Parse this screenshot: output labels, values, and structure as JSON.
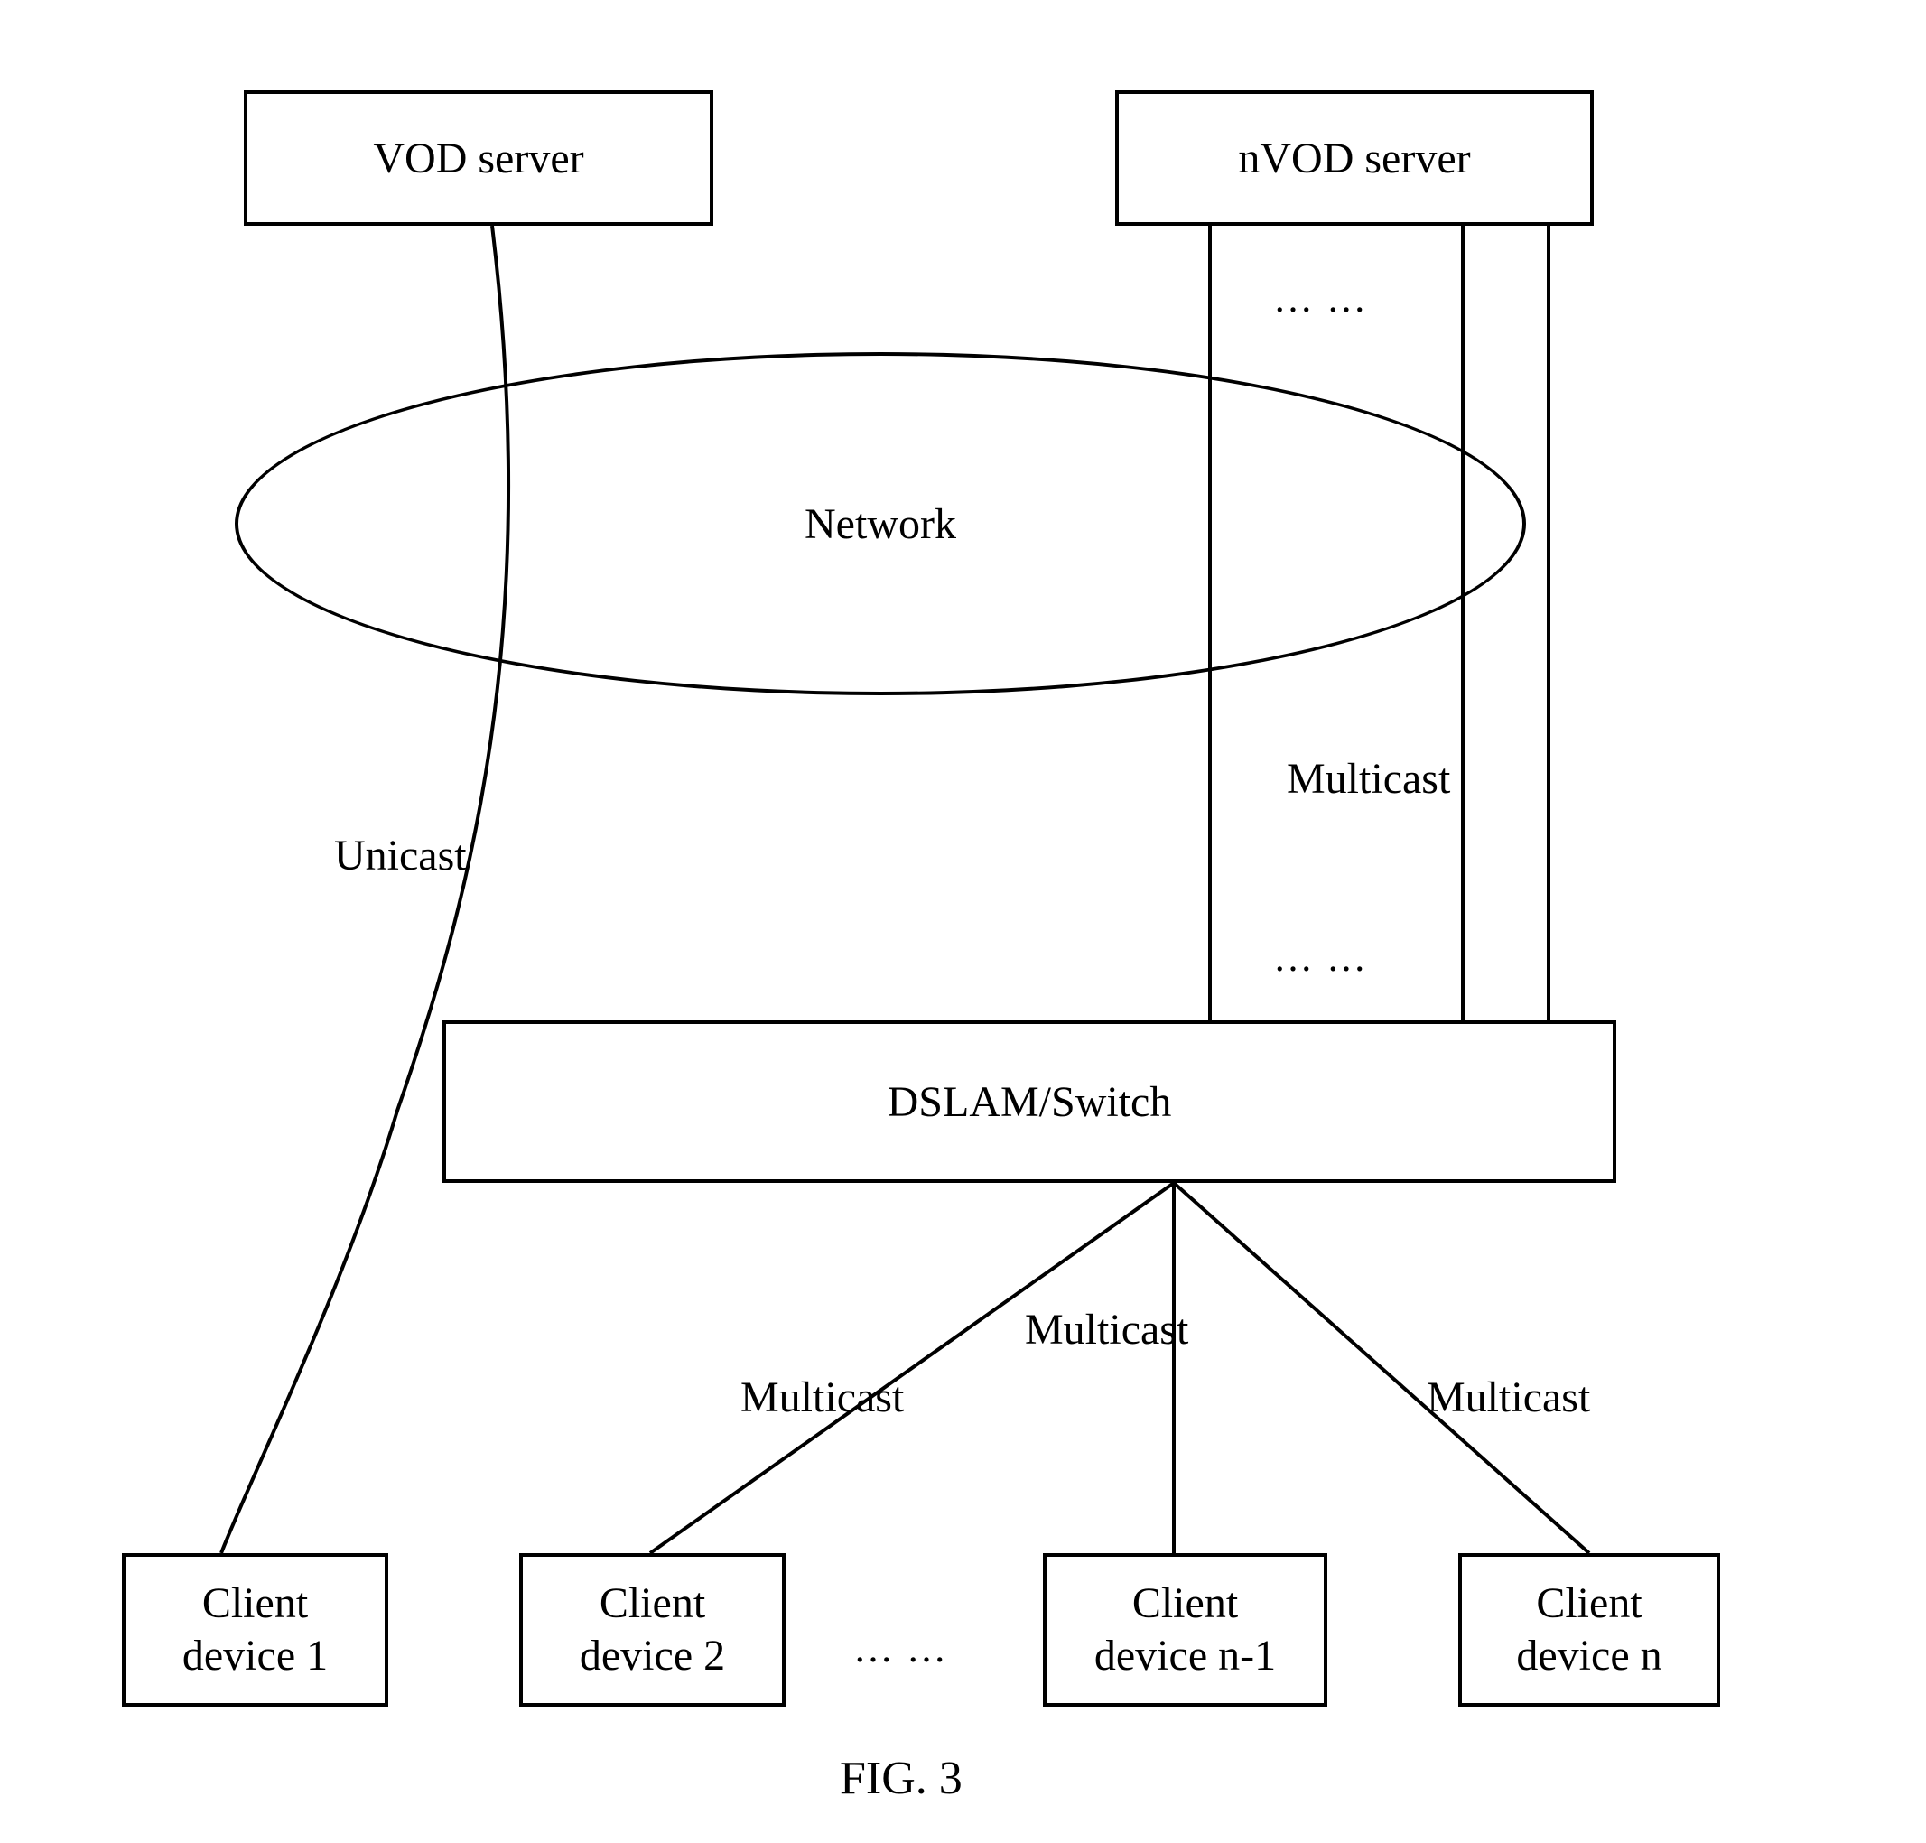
{
  "nodes": {
    "vod_server": "VOD server",
    "nvod_server": "nVOD server",
    "network": "Network",
    "dslam": "DSLAM/Switch",
    "client1": "Client\ndevice 1",
    "client2": "Client\ndevice 2",
    "client_nm1": "Client\ndevice n-1",
    "client_n": "Client\ndevice n"
  },
  "labels": {
    "unicast": "Unicast",
    "multicast_top": "Multicast",
    "multicast_b1": "Multicast",
    "multicast_b2": "Multicast",
    "multicast_b3": "Multicast"
  },
  "ellipses": {
    "top_dots": "… …",
    "mid_dots": "… …",
    "bottom_dots": "… …"
  },
  "caption": "FIG. 3"
}
